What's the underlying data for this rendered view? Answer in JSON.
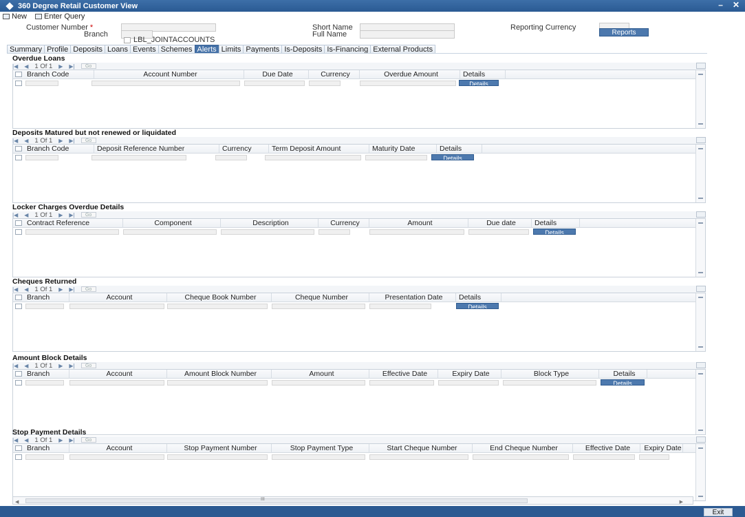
{
  "window": {
    "title": "360 Degree Retail Customer View"
  },
  "toolbar": {
    "new_label": "New",
    "enter_query_label": "Enter Query"
  },
  "header": {
    "customer_number_label": "Customer Number",
    "required_marker": "*",
    "branch_label": "Branch",
    "joint_accounts_label": "LBL_JOINTACCOUNTS",
    "short_name_label": "Short Name",
    "full_name_label": "Full Name",
    "reporting_currency_label": "Reporting Currency",
    "reports_button": "Reports"
  },
  "tabs": [
    "Summary",
    "Profile",
    "Deposits",
    "Loans",
    "Events",
    "Schemes",
    "Alerts",
    "Limits",
    "Payments",
    "Is-Deposits",
    "Is-Financing",
    "External Products"
  ],
  "active_tab": "Alerts",
  "pager": {
    "text": "1 Of 1",
    "go": "Go"
  },
  "details_button": "Details",
  "sections": [
    {
      "title": "Overdue Loans",
      "columns": [
        "Branch Code",
        "Account Number",
        "Due Date",
        "Currency",
        "Overdue Amount",
        "Details"
      ]
    },
    {
      "title": "Deposits Matured but not renewed or liquidated",
      "columns": [
        "Branch Code",
        "Deposit Reference Number",
        "Currency",
        "Term Deposit Amount",
        "Maturity Date",
        "Details"
      ]
    },
    {
      "title": "Locker Charges Overdue Details",
      "columns": [
        "Contract Reference",
        "Component",
        "Description",
        "Currency",
        "Amount",
        "Due date",
        "Details"
      ]
    },
    {
      "title": "Cheques Returned",
      "columns": [
        "Branch",
        "Account",
        "Cheque Book Number",
        "Cheque Number",
        "Presentation Date",
        "Details"
      ]
    },
    {
      "title": "Amount Block Details",
      "columns": [
        "Branch",
        "Account",
        "Amount Block Number",
        "Amount",
        "Effective Date",
        "Expiry Date",
        "Block Type",
        "Details"
      ]
    },
    {
      "title": "Stop Payment Details",
      "columns": [
        "Branch",
        "Account",
        "Stop Payment Number",
        "Stop Payment Type",
        "Start Cheque Number",
        "End Cheque Number",
        "Effective Date",
        "Expiry Date"
      ]
    }
  ],
  "footer": {
    "exit_button": "Exit",
    "scroll_dots": "III"
  }
}
